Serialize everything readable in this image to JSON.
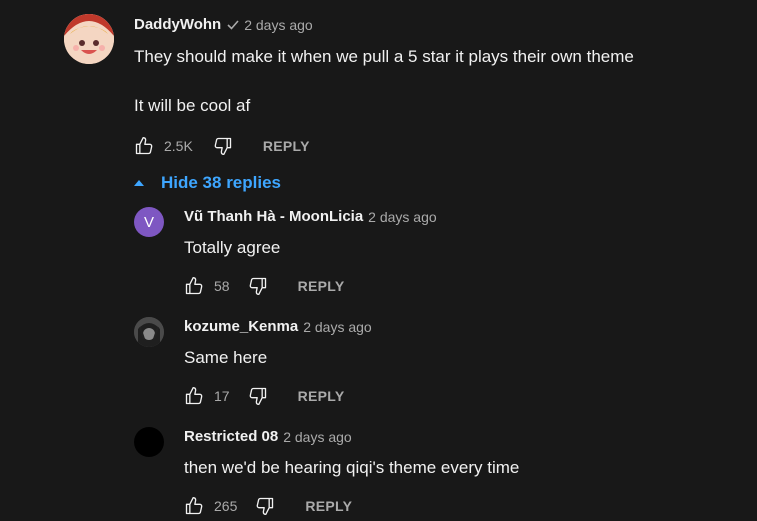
{
  "comment": {
    "author": "DaddyWohn",
    "time": "2 days ago",
    "text_line1": "They should make it when we pull a 5 star it plays their own theme",
    "text_line2": "It will be cool af",
    "likes": "2.5K",
    "reply_label": "REPLY"
  },
  "toggle": {
    "label": "Hide 38 replies"
  },
  "replies": [
    {
      "author": "Vũ Thanh Hà - MoonLicia",
      "time": "2 days ago",
      "text": "Totally agree",
      "likes": "58",
      "reply_label": "REPLY",
      "avatar_letter": "V",
      "avatar_color": "#7e57c2"
    },
    {
      "author": "kozume_Kenma",
      "time": "2 days ago",
      "text": "Same here",
      "likes": "17",
      "reply_label": "REPLY"
    },
    {
      "author": "Restricted 08",
      "time": "2 days ago",
      "text": "then we'd be hearing qiqi's theme every time",
      "likes": "265",
      "reply_label": "REPLY"
    }
  ],
  "colors": {
    "background": "#181818",
    "link": "#3ea6ff",
    "secondary_text": "#aaaaaa"
  },
  "icons": [
    "verified-check-icon",
    "thumbs-up-icon",
    "thumbs-down-icon",
    "caret-up-icon"
  ]
}
